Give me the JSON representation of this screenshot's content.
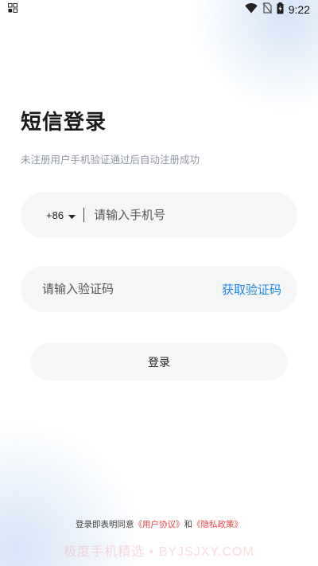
{
  "status_bar": {
    "time": "9:22",
    "left_icon": "notification-grid-icon",
    "icons": [
      "wifi-icon",
      "no-sim-icon",
      "battery-charging-icon"
    ]
  },
  "login": {
    "title": "短信登录",
    "subtitle": "未注册用户手机验证通过后自动注册成功",
    "country_code": "+86",
    "phone_placeholder": "请输入手机号",
    "code_placeholder": "请输入验证码",
    "get_code_label": "获取验证码",
    "login_button": "登录"
  },
  "agreement": {
    "prefix": "登录即表明同意",
    "user_agreement": "《用户协议》",
    "connector": "和",
    "privacy_policy": "《隐私政策》"
  },
  "watermark": "极度手机精选 • BYJSJXY.COM",
  "colors": {
    "accent_blue": "#1f86e6",
    "link_red": "#e84545",
    "field_bg": "#f5f6f8"
  }
}
